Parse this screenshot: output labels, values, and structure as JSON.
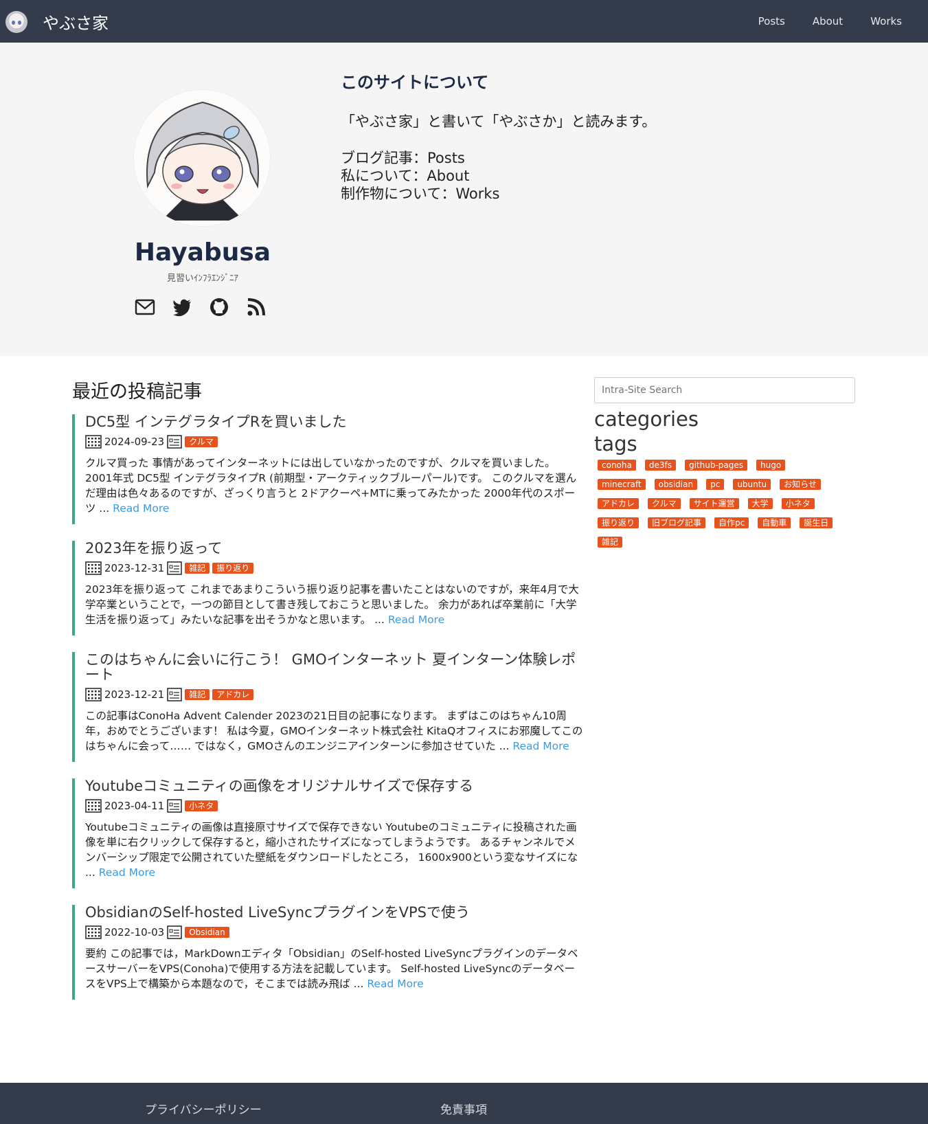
{
  "nav": {
    "brand": "やぶさ家",
    "links": [
      "Posts",
      "About",
      "Works"
    ]
  },
  "profile": {
    "name": "Hayabusa",
    "subtitle": "見習いｲﾝﾌﾗｴﾝｼﾞﾆｱ",
    "social_icons": [
      "mail-icon",
      "twitter-icon",
      "github-icon",
      "rss-icon"
    ]
  },
  "about": {
    "title": "このサイトについて",
    "lead": "「やぶさ家」と書いて「やぶさか」と読みます。",
    "lines": [
      "ブログ記事：Posts",
      "私について：About",
      "制作物について：Works"
    ]
  },
  "recent": {
    "title": "最近の投稿記事",
    "read_more": "Read More",
    "posts": [
      {
        "title": "DC5型 インテグラタイプRを買いました",
        "date": "2024-09-23",
        "tags": [
          "クルマ"
        ],
        "summary": "クルマ買った 事情があってインターネットには出していなかったのですが、クルマを買いました。 2001年式 DC5型 インテグラタイプR (前期型・アークティックブルーパール)です。 このクルマを選んだ理由は色々あるのですが、ざっくり言うと 2ドアクーペ+MTに乗ってみたかった 2000年代のスポーツ ..."
      },
      {
        "title": "2023年を振り返って",
        "date": "2023-12-31",
        "tags": [
          "雑記",
          "振り返り"
        ],
        "summary": "2023年を振り返って これまであまりこういう振り返り記事を書いたことはないのですが，来年4月で大学卒業ということで，一つの節目として書き残しておこうと思いました。 余力があれば卒業前に「大学生活を振り返って」みたいな記事を出そうかなと思います。 ..."
      },
      {
        "title": "このはちゃんに会いに行こう！ GMOインターネット 夏インターン体験レポート",
        "date": "2023-12-21",
        "tags": [
          "雑記",
          "アドカレ"
        ],
        "summary": "この記事はConoHa Advent Calender 2023の21日目の記事になります。 まずはこのはちゃん10周年，おめでとうございます！ 私は今夏，GMOインターネット株式会社 KitaQオフィスにお邪魔してこのはちゃんに会って…… ではなく，GMOさんのエンジニアインターンに参加させていた ..."
      },
      {
        "title": "Youtubeコミュニティの画像をオリジナルサイズで保存する",
        "date": "2023-04-11",
        "tags": [
          "小ネタ"
        ],
        "summary": "Youtubeコミュニティの画像は直接原寸サイズで保存できない Youtubeのコミュニティに投稿された画像を単に右クリックして保存すると，縮小されたサイズになってしまうようです。 あるチャンネルでメンバーシップ限定で公開されていた壁紙をダウンロードしたところ， 1600x900という変なサイズにな ..."
      },
      {
        "title": "ObsidianのSelf-hosted LiveSyncプラグインをVPSで使う",
        "date": "2022-10-03",
        "tags": [
          "Obsidian"
        ],
        "summary": "要約 この記事では，MarkDownエディタ「Obsidian」のSelf-hosted LiveSyncプラグインのデータベースサーバーをVPS(Conoha)で使用する方法を記載しています。 Self-hosted LiveSyncのデータベースをVPS上で構築から本題なので，そこまでは読み飛ば ..."
      }
    ]
  },
  "sidebar": {
    "search_placeholder": "Intra-Site Search",
    "categories_title": "categories",
    "tags_title": "tags",
    "tags": [
      "conoha",
      "de3fs",
      "github-pages",
      "hugo",
      "minecraft",
      "obsidian",
      "pc",
      "ubuntu",
      "お知らせ",
      "アドカレ",
      "クルマ",
      "サイト運営",
      "大学",
      "小ネタ",
      "振り返り",
      "旧ブログ記事",
      "自作pc",
      "自動車",
      "誕生日",
      "雑記"
    ]
  },
  "footer": {
    "privacy": "プライバシーポリシー",
    "disclaimer": "免責事項"
  },
  "colors": {
    "navbar": "#343c4c",
    "hero_bg": "#f5f5f5",
    "badge": "#e8531d",
    "post_border": "#3fa68a",
    "link": "#3b9be3"
  }
}
